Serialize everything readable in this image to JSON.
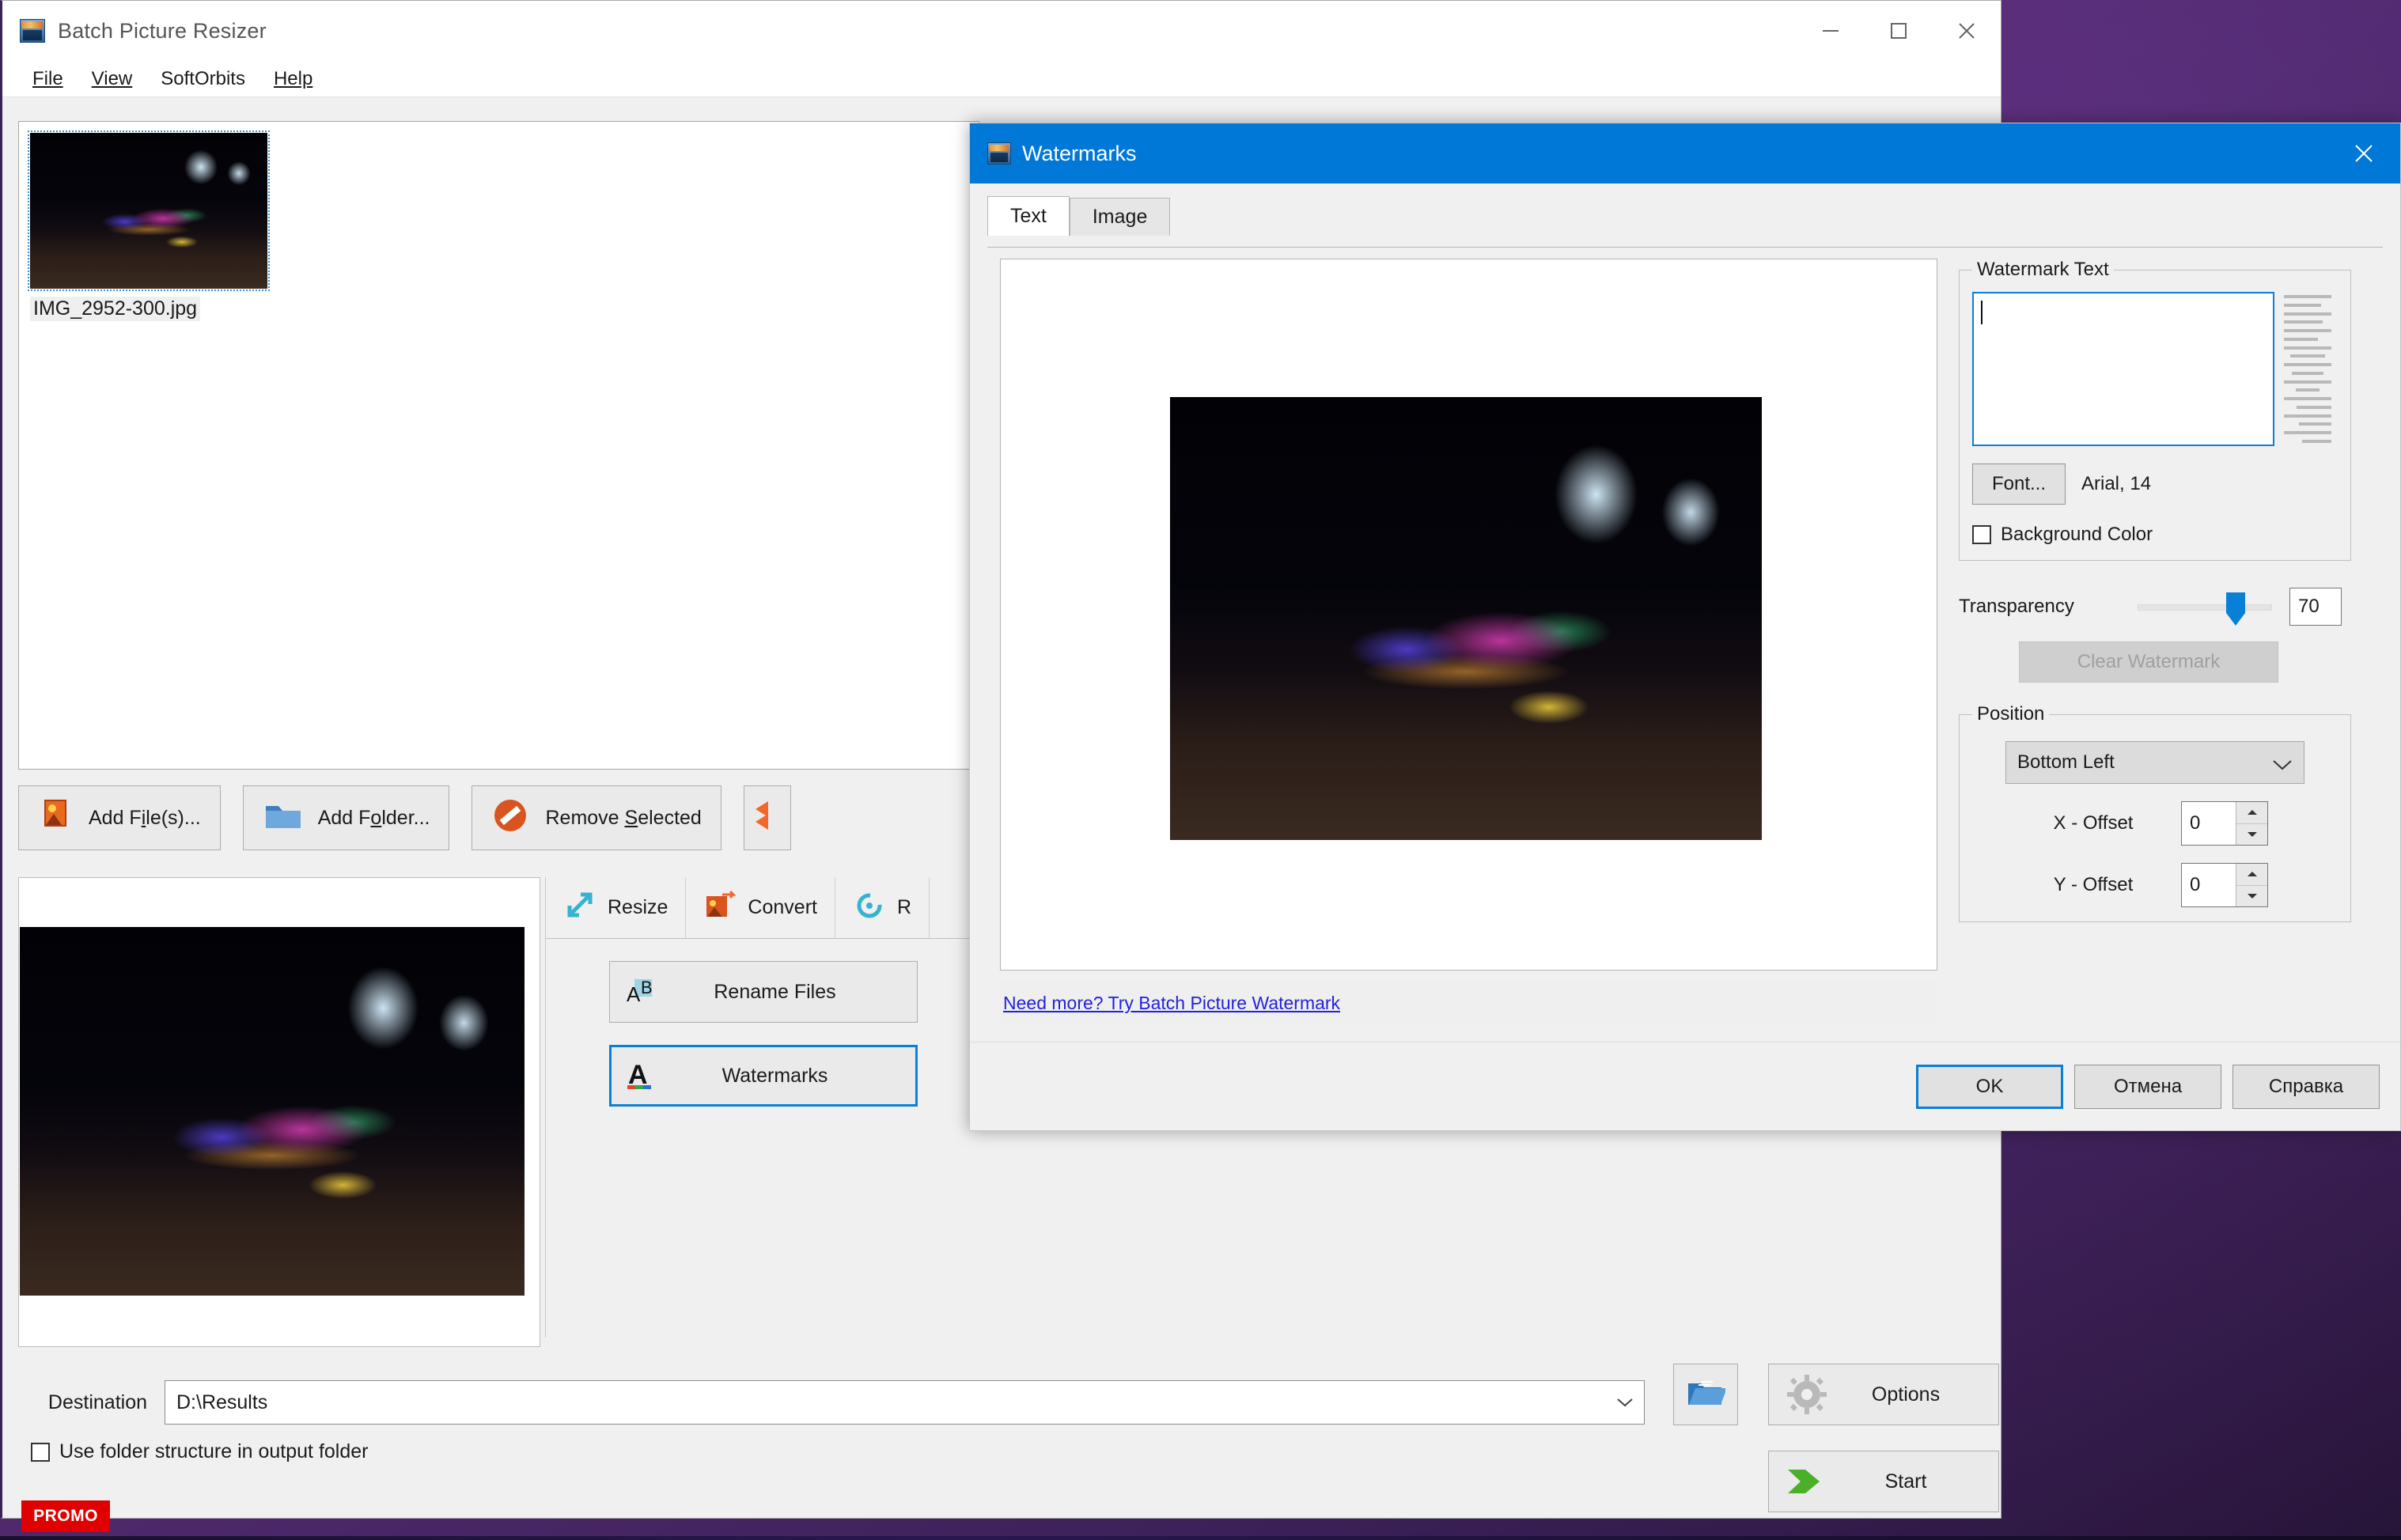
{
  "app": {
    "title": "Batch Picture Resizer",
    "icon": "app-image-icon",
    "menu": [
      "File",
      "View",
      "SoftOrbits",
      "Help"
    ],
    "window_controls": [
      "minimize",
      "maximize",
      "close"
    ]
  },
  "filelist": {
    "items": [
      {
        "name": "IMG_2952-300.jpg",
        "selected": true
      }
    ]
  },
  "actions": [
    {
      "label": "Add File(s)...",
      "icon": "add-image-icon"
    },
    {
      "label": "Add Folder...",
      "icon": "folder-icon"
    },
    {
      "label": "Remove Selected",
      "icon": "remove-icon"
    },
    {
      "label": "",
      "icon": "swap-arrows-icon"
    }
  ],
  "tool_tabs": [
    {
      "label": "Resize",
      "icon": "resize-arrow-icon"
    },
    {
      "label": "Convert",
      "icon": "convert-image-icon"
    },
    {
      "label": "R",
      "icon": "rotate-icon"
    }
  ],
  "operations": [
    {
      "label": "Rename Files",
      "icon": "rename-ab-icon",
      "selected": false
    },
    {
      "label": "Watermarks",
      "icon": "watermark-a-icon",
      "selected": true
    }
  ],
  "bottom": {
    "destination_label": "Destination",
    "destination_value": "D:\\Results",
    "use_folder_structure_label": "Use folder structure in output folder",
    "use_folder_structure_checked": false,
    "promo_badge": "PROMO",
    "browse_icon": "open-folder-icon",
    "options_label": "Options",
    "options_icon": "gear-icon",
    "start_label": "Start",
    "start_icon": "green-arrow-icon"
  },
  "dialog": {
    "title": "Watermarks",
    "icon": "app-image-icon",
    "close_icon": "close-icon",
    "tabs": [
      {
        "label": "Text",
        "active": true
      },
      {
        "label": "Image",
        "active": false
      }
    ],
    "promo_link": "Need more? Try Batch Picture Watermark",
    "watermark_text": {
      "group_label": "Watermark Text",
      "value": "",
      "font_button": "Font...",
      "font_description": "Arial, 14",
      "background_color_label": "Background Color",
      "background_color_checked": false,
      "align_icon": "text-align-icon"
    },
    "transparency": {
      "label": "Transparency",
      "value": "70",
      "slider_percent": 70
    },
    "clear_watermark": {
      "label": "Clear Watermark",
      "disabled": true
    },
    "position": {
      "group_label": "Position",
      "selected": "Bottom Left",
      "x_offset_label": "X - Offset",
      "x_offset_value": "0",
      "y_offset_label": "Y - Offset",
      "y_offset_value": "0"
    },
    "buttons": {
      "ok": "OK",
      "cancel": "Отмена",
      "help": "Справка"
    }
  },
  "colors": {
    "accent": "#0078d7",
    "focus": "#0a7fd6",
    "promo": "#e00000",
    "window_bg": "#f0f0f0",
    "desktop": "#512a6e"
  }
}
